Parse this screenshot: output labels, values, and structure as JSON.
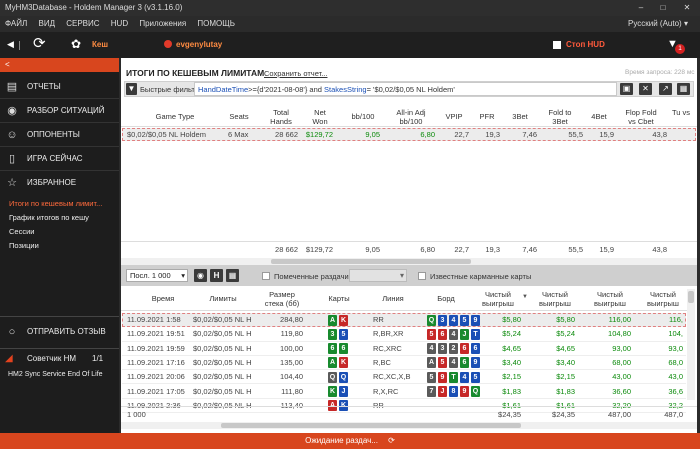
{
  "window": {
    "title": "MyHM3Database - Holdem Manager 3 (v3.1.16.0)"
  },
  "menu": {
    "items": [
      "ФАЙЛ",
      "ВИД",
      "СЕРВИС",
      "HUD",
      "Приложения",
      "ПОМОЩЬ"
    ],
    "language": "Русский (Auto)"
  },
  "toolbar": {
    "cash_label": "Кеш",
    "player": "evgenylutay",
    "hud_checkbox_label": "Стоп HUD",
    "notification_count": "1"
  },
  "sidebar": {
    "collapse_glyph": "<",
    "items": [
      {
        "label": "ОТЧЕТЫ",
        "icon": "bar-chart-icon"
      },
      {
        "label": "РАЗБОР СИТУАЦИЙ",
        "icon": "eye-icon"
      },
      {
        "label": "ОППОНЕНТЫ",
        "icon": "person-icon"
      },
      {
        "label": "ИГРА СЕЙЧАС",
        "icon": "phone-icon"
      },
      {
        "label": "ИЗБРАННОЕ",
        "icon": "star-icon"
      }
    ],
    "subitems": [
      "Итоги по кешевым лимит...",
      "График итогов по кешу",
      "Сессии",
      "Позиции"
    ],
    "feedback_label": "ОТПРАВИТЬ ОТЗЫВ",
    "advisor_label": "Советчик HM",
    "advisor_count": "1/1",
    "sync_label": "HM2 Sync Service End Of Life"
  },
  "report": {
    "title": "ИТОГИ ПО КЕШЕВЫМ ЛИМИТАМ",
    "save_link": "Сохранить отчет...",
    "request_time": "Время запроса: 228 мс",
    "filter_label": "Быстрые фильт",
    "filter_expr_1": "HandDateTime",
    "filter_expr_2": ">={d'2021-08-08'} and ",
    "filter_expr_3": "StakesString",
    "filter_expr_4": "= '$0,02/$0,05 NL Holdem'"
  },
  "summary": {
    "headers": [
      "Game Type",
      "Seats",
      "Total Hands",
      "Net Won",
      "bb/100",
      "All-in Adj bb/100",
      "VPIP",
      "PFR",
      "3Bet",
      "Fold to 3Bet",
      "4Bet",
      "Flop Fold vs Cbet",
      "Tu vs"
    ],
    "row": [
      "$0,02/$0,05 NL Holdem",
      "6 Max",
      "28 662",
      "$129,72",
      "9,05",
      "6,80",
      "22,7",
      "19,3",
      "7,46",
      "55,5",
      "15,9",
      "43,8",
      ""
    ],
    "totals": [
      "",
      "",
      "28 662",
      "$129,72",
      "9,05",
      "6,80",
      "22,7",
      "19,3",
      "7,46",
      "55,5",
      "15,9",
      "43,8",
      ""
    ]
  },
  "hands_toolbar": {
    "last_n": "Посл. 1 000",
    "marked_label": "Помеченные раздачи",
    "known_cards_label": "Известные карманные карты"
  },
  "hands": {
    "headers": [
      "Время",
      "Лимиты",
      "Размер стека (бб)",
      "Карты",
      "Линия",
      "Борд",
      "Чистый выигрыш",
      "Чистый выигрыш",
      "Чистый выигрыш",
      "Чистый выигрыш"
    ],
    "rows": [
      {
        "time": "11.09.2021 1:58",
        "limit": "$0,02/$0,05 NL H",
        "stack": "284,80",
        "cards": [
          [
            "A",
            "c-grn"
          ],
          [
            "K",
            "c-red"
          ]
        ],
        "line": "RR",
        "board": [
          [
            "Q",
            "c-grn"
          ],
          [
            "3",
            "c-blu"
          ],
          [
            "4",
            "c-blu"
          ],
          [
            "5",
            "c-blu"
          ],
          [
            "9",
            "c-blu"
          ]
        ],
        "w1": "$5,80",
        "w2": "$5,80",
        "w3": "116,00",
        "w4": "116,"
      },
      {
        "time": "11.09.2021 19:51",
        "limit": "$0,02/$0,05 NL H",
        "stack": "119,80",
        "cards": [
          [
            "3",
            "c-grn"
          ],
          [
            "5",
            "c-blu"
          ]
        ],
        "line": "R,BR,XR",
        "board": [
          [
            "5",
            "c-red"
          ],
          [
            "6",
            "c-red"
          ],
          [
            "4",
            "c-gry"
          ],
          [
            "J",
            "c-grn"
          ],
          [
            "T",
            "c-blu"
          ]
        ],
        "w1": "$5,24",
        "w2": "$5,24",
        "w3": "104,80",
        "w4": "104,"
      },
      {
        "time": "11.09.2021 19:59",
        "limit": "$0,02/$0,05 NL H",
        "stack": "100,00",
        "cards": [
          [
            "6",
            "c-grn"
          ],
          [
            "6",
            "c-grn"
          ]
        ],
        "line": "RC,XRC",
        "board": [
          [
            "4",
            "c-gry"
          ],
          [
            "3",
            "c-gry"
          ],
          [
            "2",
            "c-gry"
          ],
          [
            "6",
            "c-red"
          ],
          [
            "6",
            "c-blu"
          ]
        ],
        "w1": "$4,65",
        "w2": "$4,65",
        "w3": "93,00",
        "w4": "93,0"
      },
      {
        "time": "11.09.2021 17:16",
        "limit": "$0,02/$0,05 NL H",
        "stack": "135,00",
        "cards": [
          [
            "A",
            "c-grn"
          ],
          [
            "K",
            "c-red"
          ]
        ],
        "line": "R,BC",
        "board": [
          [
            "A",
            "c-gry"
          ],
          [
            "5",
            "c-red"
          ],
          [
            "4",
            "c-gry"
          ],
          [
            "6",
            "c-grn"
          ],
          [
            "9",
            "c-blu"
          ]
        ],
        "w1": "$3,40",
        "w2": "$3,40",
        "w3": "68,00",
        "w4": "68,0"
      },
      {
        "time": "11.09.2021 20:06",
        "limit": "$0,02/$0,05 NL H",
        "stack": "104,40",
        "cards": [
          [
            "Q",
            "c-gry"
          ],
          [
            "Q",
            "c-blu"
          ]
        ],
        "line": "RC,XC,X,B",
        "board": [
          [
            "5",
            "c-gry"
          ],
          [
            "9",
            "c-red"
          ],
          [
            "T",
            "c-grn"
          ],
          [
            "4",
            "c-blu"
          ],
          [
            "5",
            "c-blu"
          ]
        ],
        "w1": "$2,15",
        "w2": "$2,15",
        "w3": "43,00",
        "w4": "43,0"
      },
      {
        "time": "11.09.2021 17:05",
        "limit": "$0,02/$0,05 NL H",
        "stack": "111,80",
        "cards": [
          [
            "K",
            "c-grn"
          ],
          [
            "J",
            "c-blu"
          ]
        ],
        "line": "R,X,RC",
        "board": [
          [
            "7",
            "c-gry"
          ],
          [
            "J",
            "c-red"
          ],
          [
            "8",
            "c-blu"
          ],
          [
            "9",
            "c-red"
          ],
          [
            "Q",
            "c-grn"
          ]
        ],
        "w1": "$1,83",
        "w2": "$1,83",
        "w3": "36,60",
        "w4": "36,6"
      },
      {
        "time": "11.09.2021 2:36",
        "limit": "$0,02/$0,05 NL H",
        "stack": "113,40",
        "cards": [
          [
            "A",
            "c-red"
          ],
          [
            "K",
            "c-blu"
          ]
        ],
        "line": "RR",
        "board": [],
        "w1": "$1,61",
        "w2": "$1,61",
        "w3": "32,20",
        "w4": "32,2"
      }
    ],
    "totals": {
      "count": "1 000",
      "w1": "$24,35",
      "w2": "$24,35",
      "w3": "487,00",
      "w4": "487,0"
    }
  },
  "status": {
    "text": "Ожидание раздач..."
  }
}
